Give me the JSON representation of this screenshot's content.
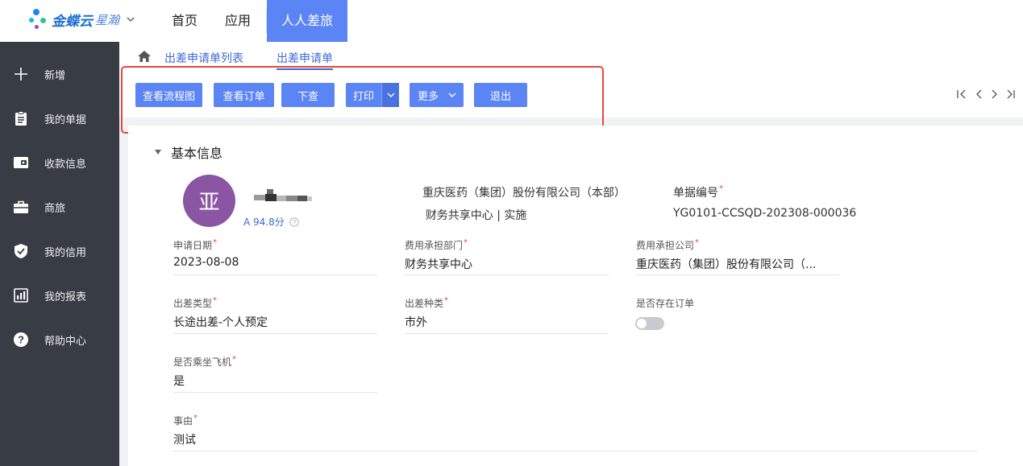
{
  "topbar": {
    "logo": {
      "brand_primary": "金蝶云",
      "brand_secondary": "星瀚"
    },
    "nav": [
      {
        "label": "首页"
      },
      {
        "label": "应用"
      },
      {
        "label": "人人差旅"
      }
    ],
    "active_nav": "人人差旅",
    "accent_color": "#5b84f4"
  },
  "sidebar": {
    "items": [
      {
        "label": "新增",
        "icon": "plus-icon"
      },
      {
        "label": "我的单据",
        "icon": "clipboard-icon"
      },
      {
        "label": "收款信息",
        "icon": "wallet-icon"
      },
      {
        "label": "商旅",
        "icon": "briefcase-icon"
      },
      {
        "label": "我的信用",
        "icon": "shield-check-icon"
      },
      {
        "label": "我的报表",
        "icon": "chart-icon"
      },
      {
        "label": "帮助中心",
        "icon": "help-icon"
      }
    ]
  },
  "breadcrumb": {
    "items": [
      {
        "label": "出差申请单列表"
      },
      {
        "label": "出差申请单"
      }
    ]
  },
  "toolbar": {
    "view_flow": "查看流程图",
    "view_order": "查看订单",
    "push_down": "下查",
    "print": "打印",
    "more": "更多",
    "exit": "退出"
  },
  "section": {
    "title": "基本信息"
  },
  "profile": {
    "avatar_char": "亚",
    "score": "A 94.8分",
    "org": "重庆医药（集团）股份有限公司（本部）",
    "dept": "财务共享中心 | 实施",
    "doc_no_label": "单据编号",
    "doc_no": "YG0101-CCSQD-202308-000036"
  },
  "fields": {
    "apply_date": {
      "label": "申请日期",
      "value": "2023-08-08"
    },
    "cost_dept": {
      "label": "费用承担部门",
      "value": "财务共享中心"
    },
    "cost_company": {
      "label": "费用承担公司",
      "value": "重庆医药（集团）股份有限公司（..."
    },
    "trip_type": {
      "label": "出差类型",
      "value": "长途出差-个人预定"
    },
    "trip_kind": {
      "label": "出差种类",
      "value": "市外"
    },
    "has_order": {
      "label": "是否存在订单",
      "value": false
    },
    "by_plane": {
      "label": "是否乘坐飞机",
      "value": "是"
    },
    "reason": {
      "label": "事由",
      "value": "测试"
    }
  }
}
